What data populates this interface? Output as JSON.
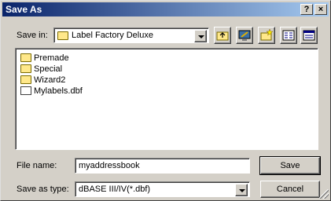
{
  "window": {
    "title": "Save As",
    "help_button": "?",
    "close_button": "×"
  },
  "save_in": {
    "label": "Save in:",
    "value": "Label Factory Deluxe"
  },
  "toolbar": {
    "up_icon": "up-one-level-icon",
    "desktop_icon": "desktop-icon",
    "new_folder_icon": "new-folder-icon",
    "list_icon": "list-view-icon",
    "details_icon": "details-view-icon"
  },
  "files": [
    {
      "name": "Premade",
      "type": "folder"
    },
    {
      "name": "Special",
      "type": "folder"
    },
    {
      "name": "Wizard2",
      "type": "folder"
    },
    {
      "name": "Mylabels.dbf",
      "type": "file"
    }
  ],
  "file_name": {
    "label": "File name:",
    "value": "myaddressbook"
  },
  "save_as_type": {
    "label": "Save as type:",
    "value": "dBASE III/IV(*.dbf)"
  },
  "buttons": {
    "save": "Save",
    "cancel": "Cancel"
  }
}
